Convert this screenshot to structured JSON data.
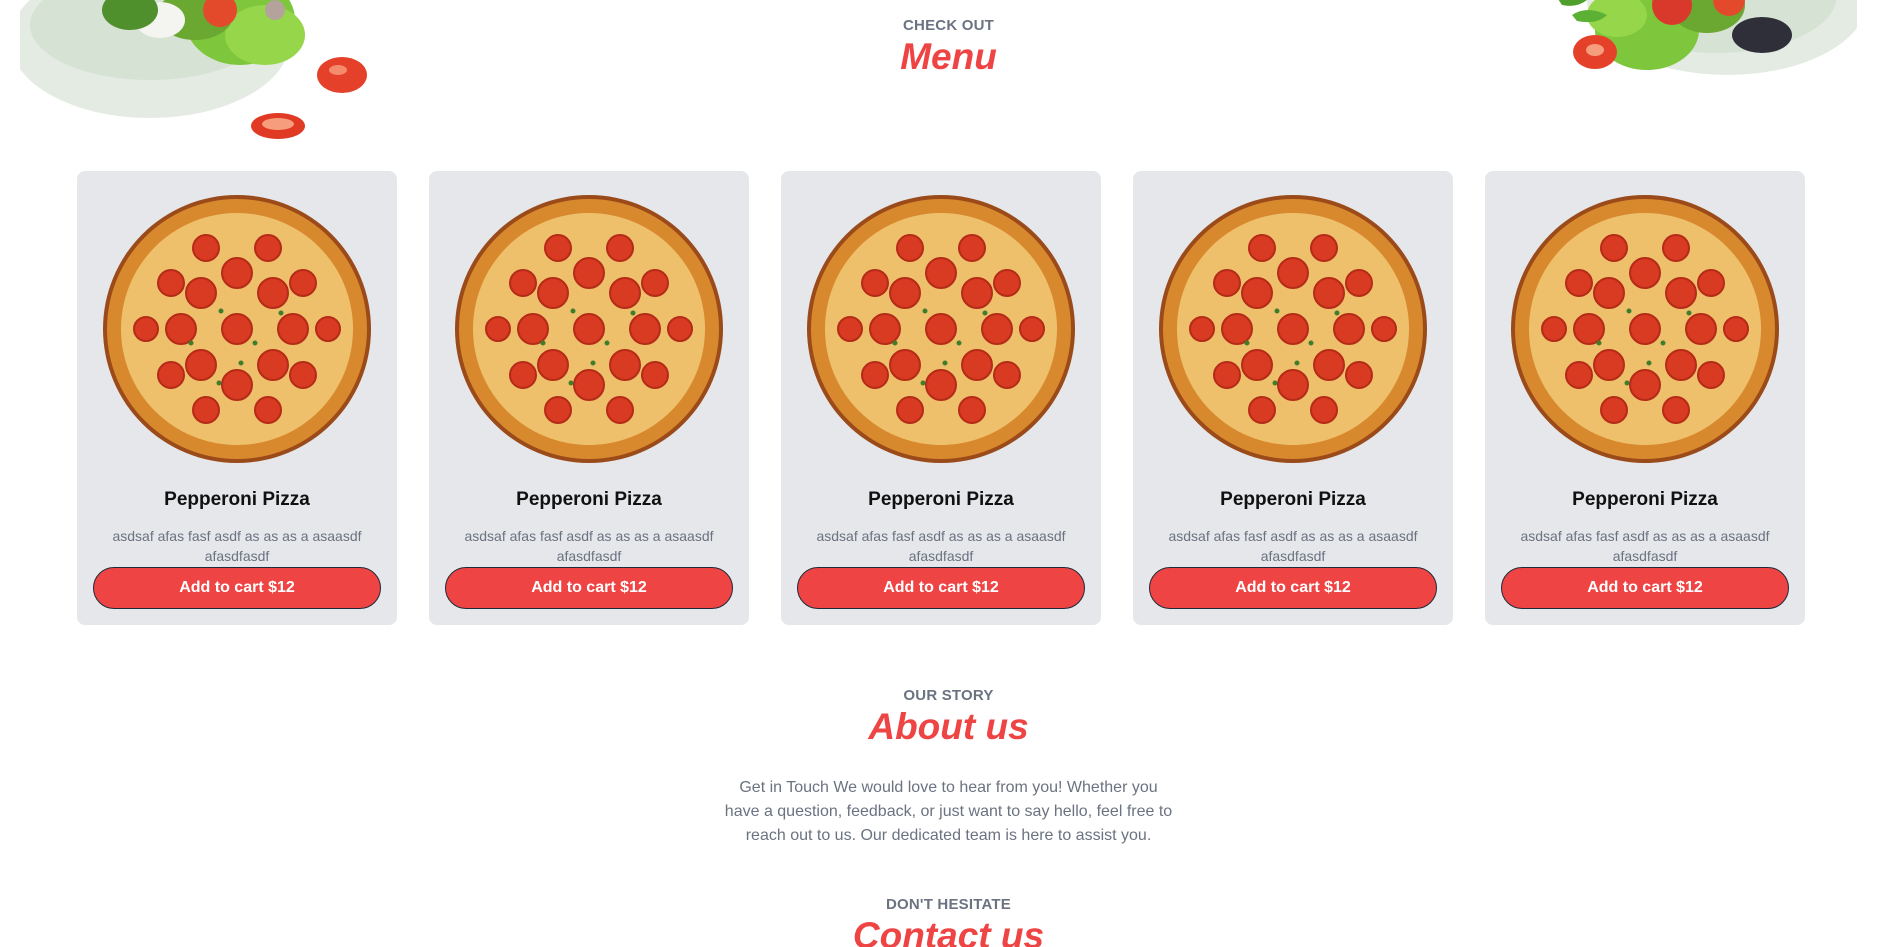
{
  "menu_section": {
    "eyebrow": "CHECK OUT",
    "title": "Menu"
  },
  "menu_items": [
    {
      "name": "Pepperoni Pizza",
      "description": "asdsaf afas fasf asdf as as as a asaasdf afasdfasdf",
      "button_label": "Add to cart $12"
    },
    {
      "name": "Pepperoni Pizza",
      "description": "asdsaf afas fasf asdf as as as a asaasdf afasdfasdf",
      "button_label": "Add to cart $12"
    },
    {
      "name": "Pepperoni Pizza",
      "description": "asdsaf afas fasf asdf as as as a asaasdf afasdfasdf",
      "button_label": "Add to cart $12"
    },
    {
      "name": "Pepperoni Pizza",
      "description": "asdsaf afas fasf asdf as as as a asaasdf afasdfasdf",
      "button_label": "Add to cart $12"
    },
    {
      "name": "Pepperoni Pizza",
      "description": "asdsaf afas fasf asdf as as as a asaasdf afasdfasdf",
      "button_label": "Add to cart $12"
    }
  ],
  "about_section": {
    "eyebrow": "OUR STORY",
    "title": "About us",
    "text": "Get in Touch We would love to hear from you! Whether you have a question, feedback, or just want to say hello, feel free to reach out to us. Our dedicated team is here to assist you."
  },
  "contact_section": {
    "eyebrow": "DON'T HESITATE",
    "title": "Contact us"
  },
  "colors": {
    "accent": "#ef4444",
    "muted_text": "#6b7280",
    "card_bg": "#e5e7eb"
  },
  "icons": {
    "salad_left": "salad-bowl-icon",
    "salad_right": "salad-bowl-icon",
    "pizza": "pepperoni-pizza-image"
  }
}
